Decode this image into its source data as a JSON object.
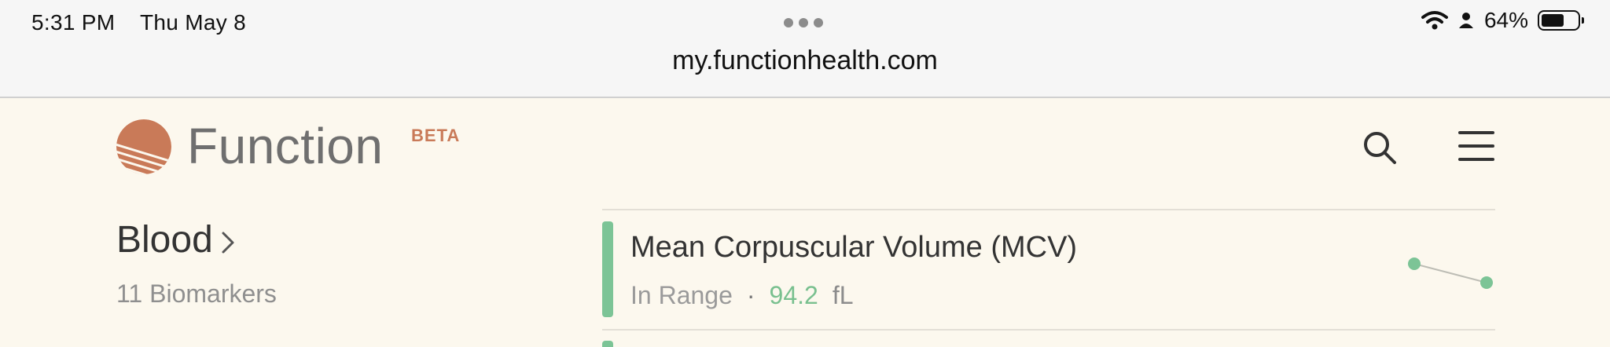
{
  "status_bar": {
    "time": "5:31 PM",
    "date": "Thu May 8",
    "battery_percent": "64%",
    "battery_level": 0.64
  },
  "browser": {
    "url": "my.functionhealth.com"
  },
  "header": {
    "brand": "Function",
    "beta_badge": "BETA"
  },
  "category": {
    "title": "Blood",
    "count_label": "11 Biomarkers"
  },
  "biomarkers": [
    {
      "name": "Mean Corpuscular Volume (MCV)",
      "status": "In Range",
      "separator": "·",
      "value": "94.2",
      "unit": "fL",
      "status_color": "#7cc496"
    }
  ],
  "colors": {
    "accent_green": "#7cc496",
    "brand_orange": "#c97a58",
    "background": "#fcf8ee"
  }
}
